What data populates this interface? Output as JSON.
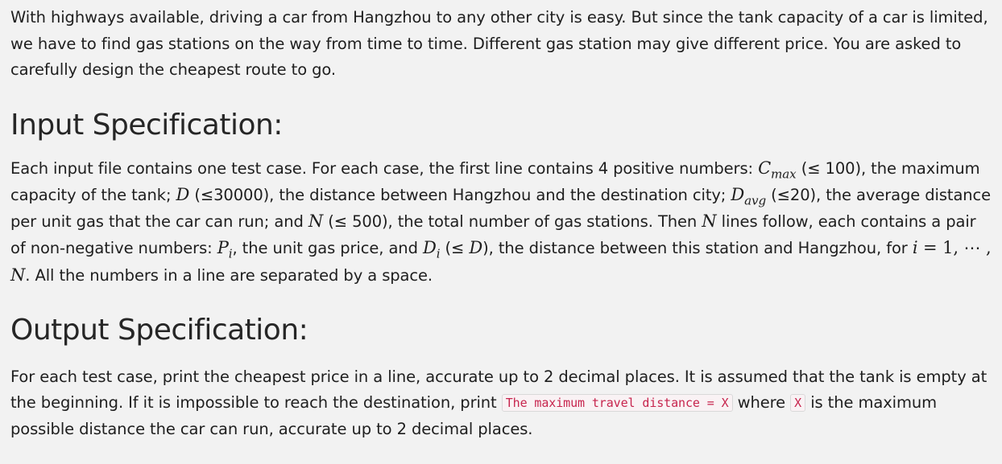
{
  "intro": {
    "text": "With highways available, driving a car from Hangzhou to any other city is easy. But since the tank capacity of a car is limited, we have to find gas stations on the way from time to time. Different gas station may give different price. You are asked to carefully design the cheapest route to go."
  },
  "input_spec": {
    "heading": "Input Specification:",
    "t1": "Each input file contains one test case. For each case, the first line contains 4 positive numbers: ",
    "cmax_base": "C",
    "cmax_sub": "max",
    "t2": " (≤ 100), the maximum capacity of the tank; ",
    "d_symbol": "D",
    "t3": " (≤30000), the distance between Hangzhou and the destination city; ",
    "davg_base": "D",
    "davg_sub": "avg",
    "t4": " (≤20), the average distance per unit gas that the car can run; and ",
    "n_symbol": "N",
    "t5": " (≤ 500), the total number of gas stations. Then ",
    "n_symbol2": "N",
    "t6": " lines follow, each contains a pair of non-negative numbers: ",
    "pi_base": "P",
    "pi_sub": "i",
    "t7": ", the unit gas price, and ",
    "di_base": "D",
    "di_sub": "i",
    "t8": " (≤ ",
    "d_symbol2": "D",
    "t9": "), the distance between this station and Hangzhou, for ",
    "i_symbol": "i",
    "range_text": " = 1, ⋯ , ",
    "n_symbol3": "N",
    "t10": ". All the numbers in a line are separated by a space."
  },
  "output_spec": {
    "heading": "Output Specification:",
    "t1": "For each test case, print the cheapest price in a line, accurate up to 2 decimal places. It is assumed that the tank is empty at the beginning. If it is impossible to reach the destination, print ",
    "code1": "The maximum travel distance = X",
    "t2": " where ",
    "code2": "X",
    "t3": " is the maximum possible distance the car can run, accurate up to 2 decimal places."
  }
}
